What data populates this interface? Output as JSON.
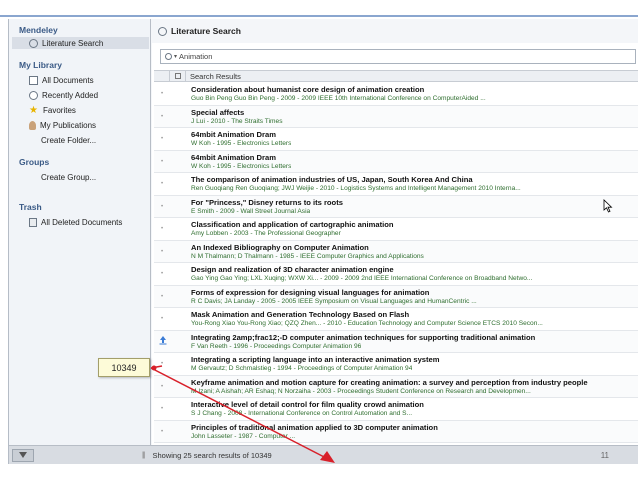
{
  "sidebar": {
    "mendeley_header": "Mendeley",
    "literature_search": "Literature Search",
    "my_library_header": "My Library",
    "library_items": [
      {
        "label": "All Documents",
        "icon": "document-icon"
      },
      {
        "label": "Recently Added",
        "icon": "clock-icon"
      },
      {
        "label": "Favorites",
        "icon": "star-icon"
      },
      {
        "label": "My Publications",
        "icon": "user-icon"
      },
      {
        "label": "Create Folder...",
        "icon": ""
      }
    ],
    "groups_header": "Groups",
    "create_group": "Create Group...",
    "trash_header": "Trash",
    "all_deleted": "All Deleted Documents"
  },
  "main": {
    "title": "Literature Search",
    "search_value": "Animation",
    "results_header": "Search Results"
  },
  "results": [
    {
      "title": "Consideration about humanist core design of animation creation",
      "meta": "Guo Bin Peng Guo Bin Peng - 2009 - 2009 IEEE 10th International Conference on ComputerAided ..."
    },
    {
      "title": "Special affects",
      "meta": "J Lui - 2010 - The Straits Times"
    },
    {
      "title": "64mbit Animation Dram",
      "meta": "W Koh - 1995 - Electronics Letters"
    },
    {
      "title": "64mbit Animation Dram",
      "meta": "W Koh - 1995 - Electronics Letters"
    },
    {
      "title": "The comparison of animation industries of US, Japan, South Korea And China",
      "meta": "Ren Guoqiang Ren Guoqiang; JWJ Weijie - 2010 - Logistics Systems and Intelligent Management 2010 Interna..."
    },
    {
      "title": "For \"Princess,\" Disney returns to its roots",
      "meta": "E Smith - 2009 - Wall Street Journal Asia"
    },
    {
      "title": "Classification and application of cartographic animation",
      "meta": "Amy Lobben - 2003 - The Professional Geographer"
    },
    {
      "title": "An Indexed Bibliography on Computer Animation",
      "meta": "N M Thalmann; D Thalmann - 1985 - IEEE Computer Graphics and Applications"
    },
    {
      "title": "Design and realization of 3D character animation engine",
      "meta": "Gao Ying Gao Ying; LXL Xuqing; WXW Xi... - 2009 - 2009 2nd IEEE International Conference on Broadband Netwo..."
    },
    {
      "title": "Forms of expression for designing visual languages for animation",
      "meta": "R C Davis; JA Landay - 2005 - 2005 IEEE Symposium on Visual Languages and HumanCentric ..."
    },
    {
      "title": "Mask Animation and Generation Technology Based on Flash",
      "meta": "You-Rong Xiao You-Rong Xiao; QZQ Zhen... - 2010 - Education Technology and Computer Science ETCS 2010 Secon..."
    },
    {
      "title": "Integrating 2amp;frac12;-D computer animation techniques for supporting traditional animation",
      "meta": "F Van Reeth - 1996 - Proceedings Computer Animation 96",
      "has_add_icon": true
    },
    {
      "title": "Integrating a scripting language into an interactive animation system",
      "meta": "M Gervautz; D Schmalstieg - 1994 - Proceedings of Computer Animation 94"
    },
    {
      "title": "Keyframe animation and motion capture for creating animation: a survey and perception from industry people",
      "meta": "M Izani; A Aishah; AR Eshaq; N Norzaiha - 2003 - Proceedings Student Conference on Research and Developmen..."
    },
    {
      "title": "Interactive level of detail control for film quality crowd animation",
      "meta": "S J Chang - 2008 - International Conference on Control Automation and S..."
    },
    {
      "title": "Principles of traditional animation applied to 3D computer animation",
      "meta": "John Lasseter - 1987 - Computer ..."
    }
  ],
  "status": {
    "text": "Showing 25 search results of 10349",
    "page_number": "11"
  },
  "callout": {
    "value": "10349"
  },
  "colors": {
    "header_blue": "#3a5a86",
    "meta_green": "#2f6e2f",
    "callout_arrow": "#d8202a",
    "callout_bg": "#fdfbd8"
  }
}
